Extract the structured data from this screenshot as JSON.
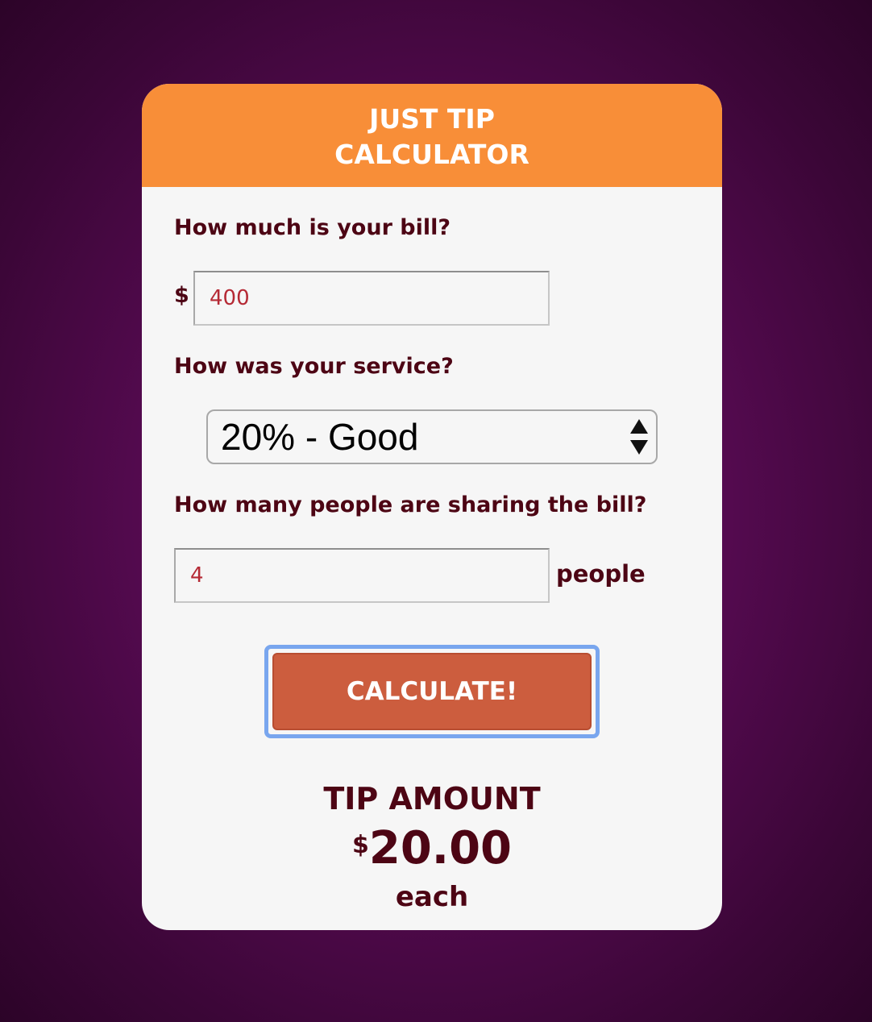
{
  "app": {
    "title_line1": "JUST TIP",
    "title_line2": "CALCULATOR"
  },
  "bill": {
    "label": "How much is your bill?",
    "currency_symbol": "$",
    "value": "400"
  },
  "service": {
    "label": "How was your service?",
    "selected_option": "20% - Good"
  },
  "people": {
    "label": "How many people are sharing the bill?",
    "value": "4",
    "suffix": "people"
  },
  "calculate_button": {
    "label": "CALCULATE!"
  },
  "result": {
    "title": "TIP AMOUNT",
    "currency_symbol": "$",
    "amount": "20.00",
    "per": "each"
  },
  "colors": {
    "header": "#f88e38",
    "text_dark": "#4d0514",
    "input_text": "#b52a35",
    "button": "#cc5d3e",
    "focus_ring": "#79a6ee"
  },
  "icons": {
    "select_arrows": "up-down-arrows-icon"
  }
}
